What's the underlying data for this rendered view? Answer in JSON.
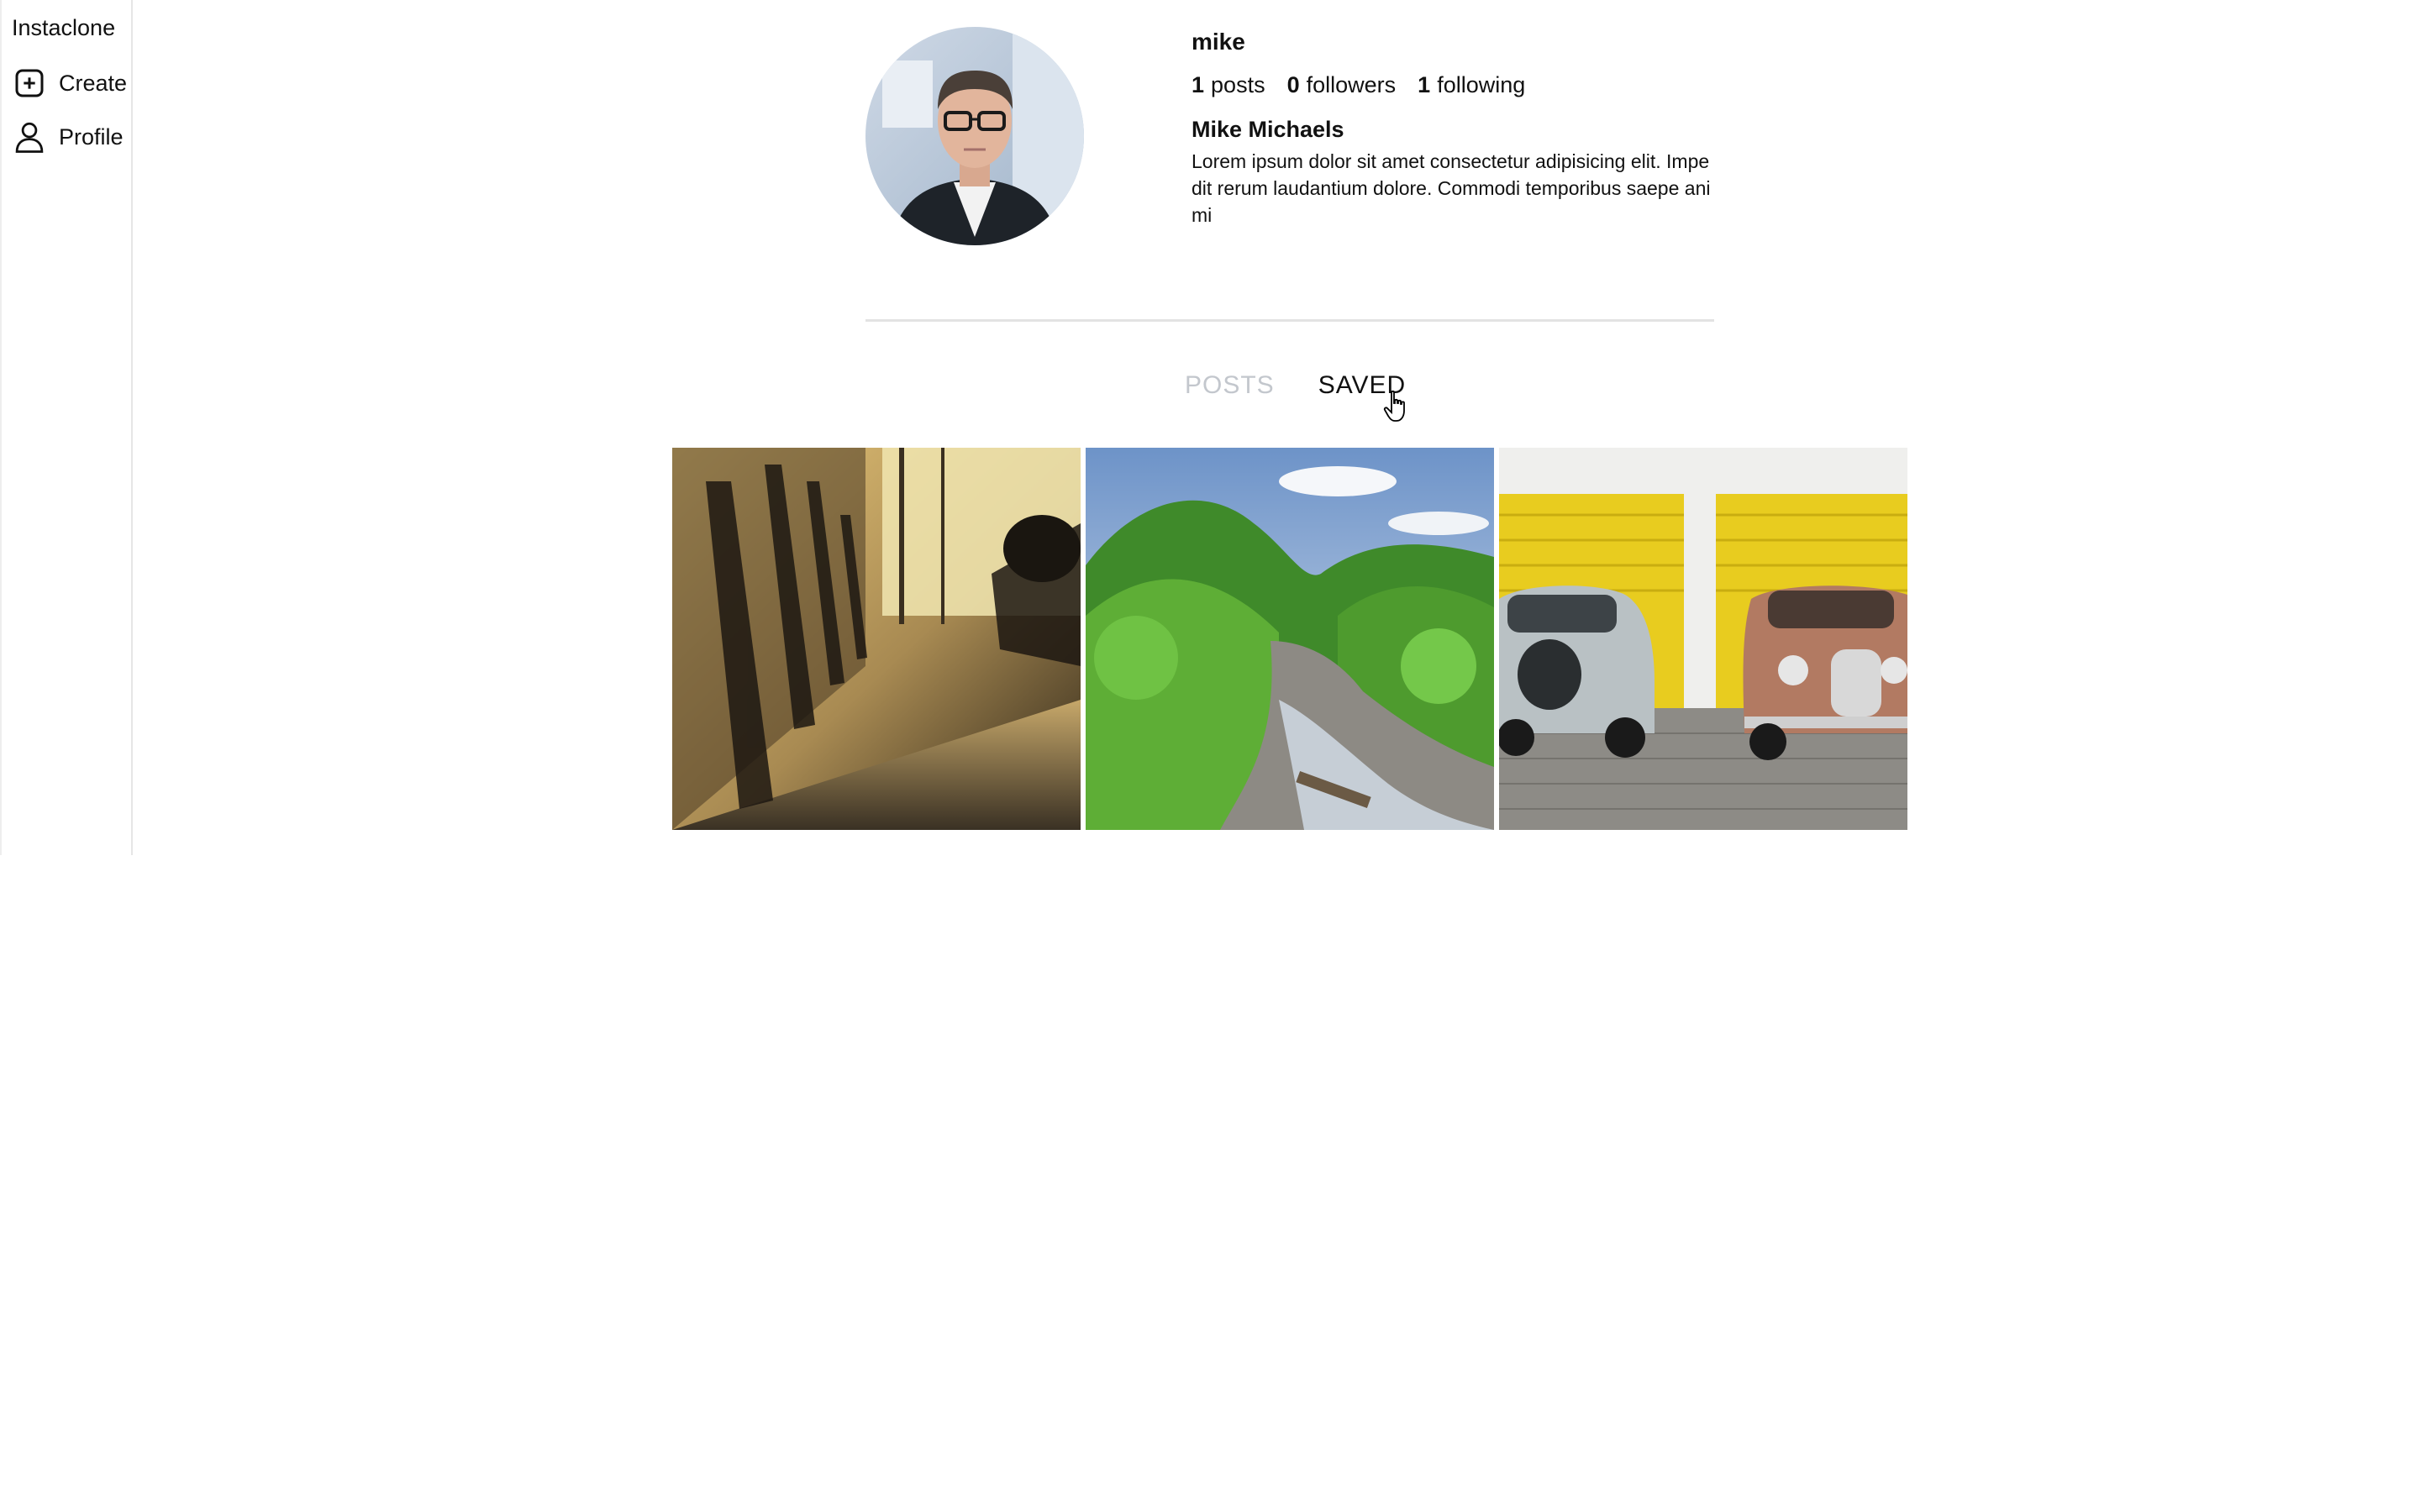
{
  "sidebar": {
    "brand": "Instaclone",
    "items": [
      {
        "label": "Create",
        "icon": "plus-square-icon"
      },
      {
        "label": "Profile",
        "icon": "user-icon"
      }
    ]
  },
  "profile": {
    "username": "mike",
    "stats": {
      "posts_count": "1",
      "posts_label": "posts",
      "followers_count": "0",
      "followers_label": "followers",
      "following_count": "1",
      "following_label": "following"
    },
    "full_name": "Mike Michaels",
    "bio": "Lorem ipsum dolor sit amet consectetur adipisicing elit. Impedit rerum laudantium dolore. Commodi temporibus saepe animi"
  },
  "tabs": [
    {
      "label": "POSTS",
      "active": false
    },
    {
      "label": "SAVED",
      "active": true
    }
  ],
  "saved_posts": [
    {
      "icon": "photo-piano-keys"
    },
    {
      "icon": "photo-forest-river"
    },
    {
      "icon": "photo-vintage-cars"
    }
  ],
  "colors": {
    "tab_inactive": "#c3c7cd",
    "tab_active": "#111111",
    "divider": "#e3e3e3"
  }
}
